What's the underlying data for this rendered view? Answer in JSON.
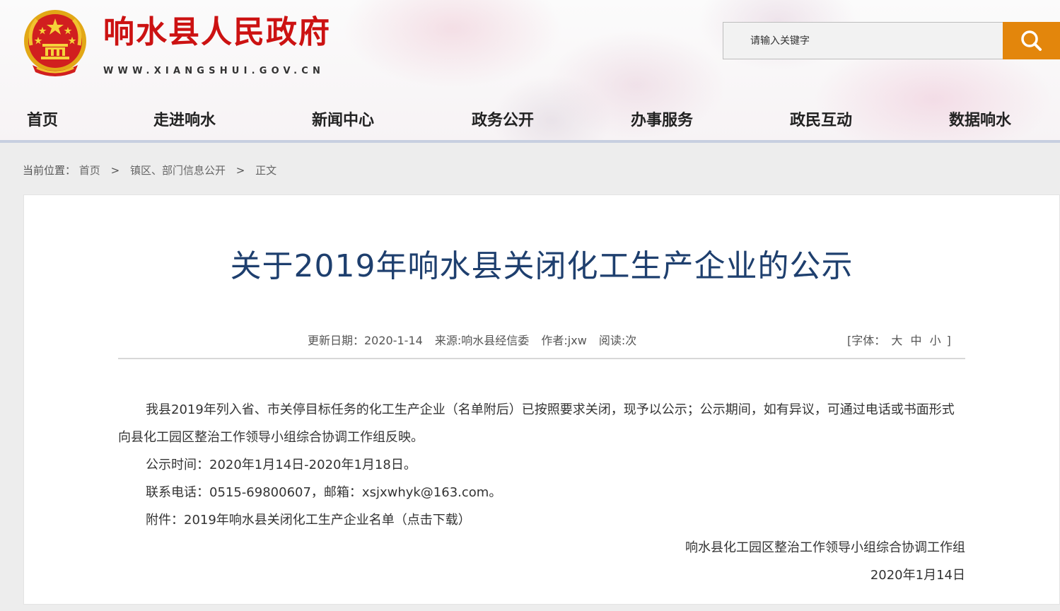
{
  "header": {
    "site_title": "响水县人民政府",
    "site_url": "WWW.XIANGSHUI.GOV.CN",
    "emblem": "national-emblem",
    "colors": {
      "title_red": "#cc1212",
      "search_orange": "#e3860c",
      "article_title_blue": "#1e3f6e"
    }
  },
  "search": {
    "placeholder": "请输入关键字",
    "button_icon": "search-icon"
  },
  "nav": {
    "items": [
      "首页",
      "走进响水",
      "新闻中心",
      "政务公开",
      "办事服务",
      "政民互动",
      "数据响水"
    ]
  },
  "breadcrumb": {
    "label": "当前位置：",
    "items": [
      "首页",
      "镇区、部门信息公开",
      "正文"
    ],
    "separator": ">"
  },
  "article": {
    "title": "关于2019年响水县关闭化工生产企业的公示",
    "meta": {
      "update_date": "更新日期：2020-1-14",
      "source": "来源:响水县经信委",
      "author": "作者:jxw",
      "reads": "阅读:次"
    },
    "font_size": {
      "prefix": "[字体：",
      "large": "大",
      "medium": "中",
      "small": "小",
      "suffix": "]"
    },
    "body": {
      "paragraph1": "我县2019年列入省、市关停目标任务的化工生产企业（名单附后）已按照要求关闭，现予以公示；公示期间，如有异议，可通过电话或书面形式向县化工园区整治工作领导小组综合协调工作组反映。",
      "period": "公示时间：2020年1月14日-2020年1月18日。",
      "contact": "联系电话：0515-69800607，邮箱：xsjxwhyk@163.com。",
      "attachment": "附件：2019年响水县关闭化工生产企业名单（点击下载）",
      "signature_org": "响水县化工园区整治工作领导小组综合协调工作组",
      "signature_date": "2020年1月14日"
    }
  }
}
